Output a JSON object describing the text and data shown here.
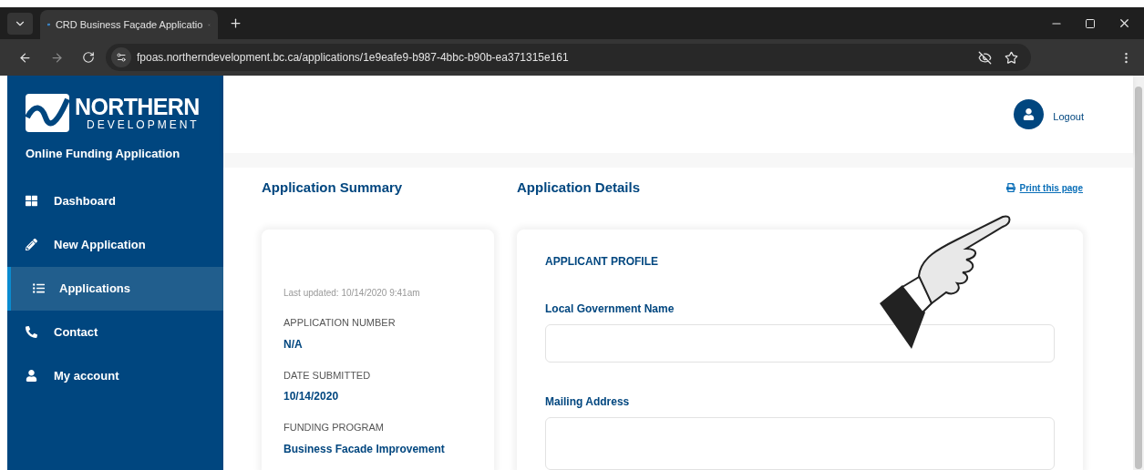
{
  "browser": {
    "tab_title": "CRD Business Façade Applicatio",
    "url": "fpoas.northerndevelopment.bc.ca/applications/1e9eafe9-b987-4bbc-b90b-ea371315e161"
  },
  "brand": {
    "name": "NORTHERN",
    "subtitle": "DEVELOPMENT",
    "tagline": "Online Funding Application"
  },
  "sidebar": {
    "items": [
      {
        "label": "Dashboard",
        "selected": false
      },
      {
        "label": "New Application",
        "selected": false
      },
      {
        "label": "Applications",
        "selected": true
      },
      {
        "label": "Contact",
        "selected": false
      },
      {
        "label": "My account",
        "selected": false
      }
    ]
  },
  "header": {
    "logout": "Logout"
  },
  "summary": {
    "title": "Application Summary",
    "last_updated": "Last updated: 10/14/2020 9:41am",
    "fields": [
      {
        "label": "APPLICATION NUMBER",
        "value": "N/A"
      },
      {
        "label": "DATE SUBMITTED",
        "value": "10/14/2020"
      },
      {
        "label": "FUNDING PROGRAM",
        "value": "Business Facade Improvement"
      }
    ]
  },
  "details": {
    "title": "Application Details",
    "print_link": "Print this page",
    "section": "APPLICANT PROFILE",
    "fields": [
      {
        "label": "Local Government Name",
        "kind": "input"
      },
      {
        "label": "Mailing Address",
        "kind": "textarea"
      }
    ]
  }
}
